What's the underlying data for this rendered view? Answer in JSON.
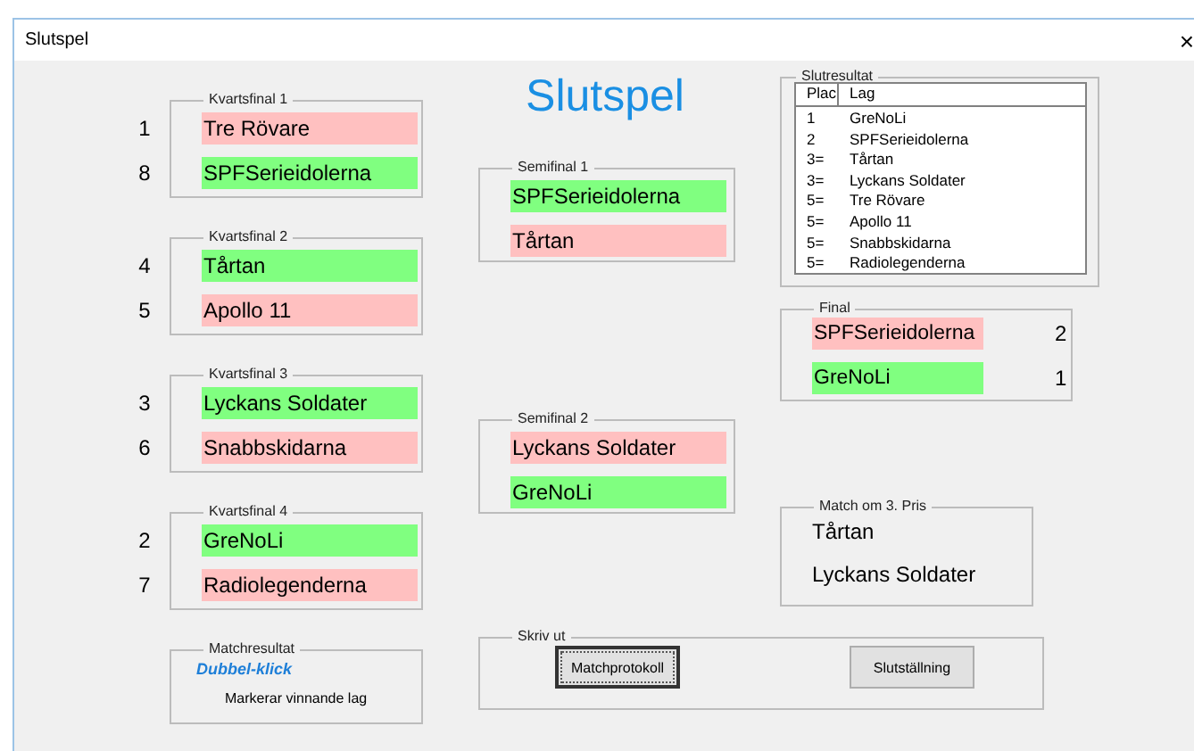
{
  "window": {
    "title": "Slutspel",
    "close": "×"
  },
  "heading": "Slutspel",
  "quarterfinals": [
    {
      "title": "Kvartsfinal 1",
      "teams": [
        {
          "seed": "1",
          "name": "Tre Rövare",
          "winner": false
        },
        {
          "seed": "8",
          "name": "SPFSerieidolerna",
          "winner": true
        }
      ]
    },
    {
      "title": "Kvartsfinal 2",
      "teams": [
        {
          "seed": "4",
          "name": "Tårtan",
          "winner": true
        },
        {
          "seed": "5",
          "name": "Apollo 11",
          "winner": false
        }
      ]
    },
    {
      "title": "Kvartsfinal 3",
      "teams": [
        {
          "seed": "3",
          "name": "Lyckans Soldater",
          "winner": true
        },
        {
          "seed": "6",
          "name": "Snabbskidarna",
          "winner": false
        }
      ]
    },
    {
      "title": "Kvartsfinal 4",
      "teams": [
        {
          "seed": "2",
          "name": "GreNoLi",
          "winner": true
        },
        {
          "seed": "7",
          "name": "Radiolegenderna",
          "winner": false
        }
      ]
    }
  ],
  "match_result": {
    "title": "Matchresultat",
    "hint": "Dubbel-klick",
    "note": "Markerar vinnande lag"
  },
  "semifinals": [
    {
      "title": "Semifinal 1",
      "teams": [
        {
          "name": "SPFSerieidolerna",
          "winner": true
        },
        {
          "name": "Tårtan",
          "winner": false
        }
      ]
    },
    {
      "title": "Semifinal 2",
      "teams": [
        {
          "name": "Lyckans Soldater",
          "winner": false
        },
        {
          "name": "GreNoLi",
          "winner": true
        }
      ]
    }
  ],
  "print": {
    "title": "Skriv ut",
    "buttons": [
      {
        "label": "Matchprotokoll",
        "focused": true
      },
      {
        "label": "Slutställning",
        "focused": false
      }
    ]
  },
  "results": {
    "title": "Slutresultat",
    "columns": [
      "Plac",
      "Lag"
    ],
    "rows": [
      {
        "place": "1",
        "team": "GreNoLi"
      },
      {
        "place": "2",
        "team": "SPFSerieidolerna"
      },
      {
        "place": "3=",
        "team": "Tårtan"
      },
      {
        "place": "3=",
        "team": "Lyckans Soldater"
      },
      {
        "place": "5=",
        "team": "Tre Rövare"
      },
      {
        "place": "5=",
        "team": "Apollo 11"
      },
      {
        "place": "5=",
        "team": "Snabbskidarna"
      },
      {
        "place": "5=",
        "team": "Radiolegenderna"
      }
    ]
  },
  "final": {
    "title": "Final",
    "teams": [
      {
        "name": "SPFSerieidolerna",
        "winner": false,
        "score": "2"
      },
      {
        "name": "GreNoLi",
        "winner": true,
        "score": "1"
      }
    ]
  },
  "third_place": {
    "title": "Match om 3. Pris",
    "teams": [
      "Tårtan",
      "Lyckans Soldater"
    ]
  }
}
